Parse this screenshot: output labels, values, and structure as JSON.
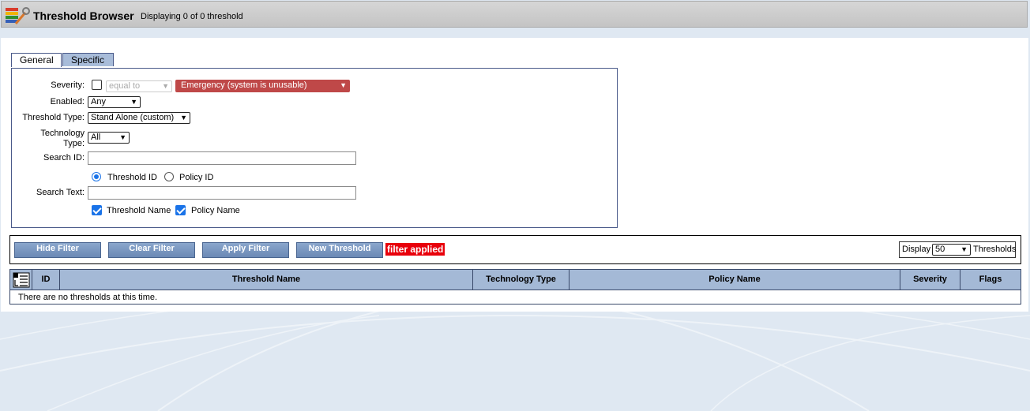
{
  "header": {
    "title": "Threshold Browser",
    "subtitle": "Displaying 0 of 0 threshold",
    "icon": "toolbox-wrench-icon"
  },
  "tabs": [
    {
      "label": "General",
      "active": true
    },
    {
      "label": "Specific",
      "active": false
    }
  ],
  "filter": {
    "severity": {
      "label": "Severity:",
      "enabled": false,
      "operator": "equal to",
      "value": "Emergency (system is unusable)",
      "value_color": "#bf4848"
    },
    "enabled": {
      "label": "Enabled:",
      "value": "Any"
    },
    "threshold_type": {
      "label": "Threshold Type:",
      "value": "Stand Alone (custom)"
    },
    "technology_type": {
      "label_line1": "Technology",
      "label_line2": "Type:",
      "value": "All"
    },
    "search_id": {
      "label": "Search ID:",
      "value": "",
      "options": [
        {
          "label": "Threshold ID",
          "selected": true
        },
        {
          "label": "Policy ID",
          "selected": false
        }
      ]
    },
    "search_text": {
      "label": "Search Text:",
      "value": "",
      "options": [
        {
          "label": "Threshold Name",
          "checked": true
        },
        {
          "label": "Policy Name",
          "checked": true
        }
      ]
    }
  },
  "toolbar": {
    "hide_filter": "Hide Filter",
    "clear_filter": "Clear Filter",
    "apply_filter": "Apply Filter",
    "new_threshold": "New Threshold",
    "filter_status": "filter applied",
    "display_label": "Display",
    "display_value": "50",
    "display_suffix": "Thresholds"
  },
  "table": {
    "columns": [
      "ID",
      "Threshold Name",
      "Technology Type",
      "Policy Name",
      "Severity",
      "Flags"
    ],
    "empty_message": "There are no thresholds at this time."
  }
}
